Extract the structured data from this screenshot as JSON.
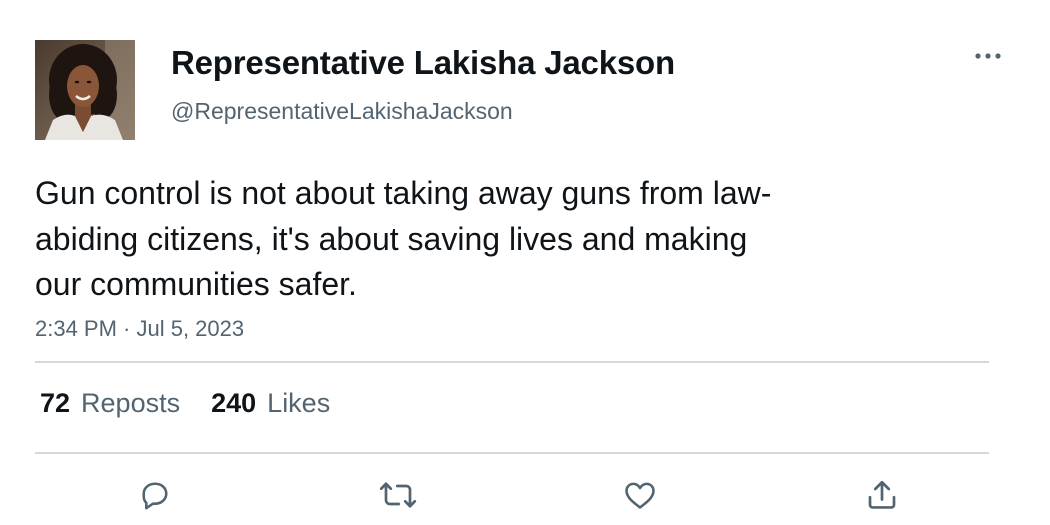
{
  "author": {
    "name": "Representative Lakisha Jackson",
    "handle": "@RepresentativeLakishaJackson",
    "avatar_icon": "profile-photo"
  },
  "more_icon": "more-horizontal-icon",
  "tweet": {
    "lines": [
      "Gun control is not about taking away guns from law-",
      "abiding citizens, it's about saving lives and making",
      "our communities safer."
    ],
    "timestamp": "2:34 PM · Jul 5, 2023"
  },
  "stats": {
    "reposts_count": "72",
    "reposts_label": "Reposts",
    "likes_count": "240",
    "likes_label": "Likes"
  },
  "actions": [
    {
      "icon": "reply-icon"
    },
    {
      "icon": "repost-icon"
    },
    {
      "icon": "like-icon"
    },
    {
      "icon": "share-icon"
    }
  ],
  "colors": {
    "text": "#0f1419",
    "secondary": "#536471",
    "divider": "#cfd9de"
  }
}
